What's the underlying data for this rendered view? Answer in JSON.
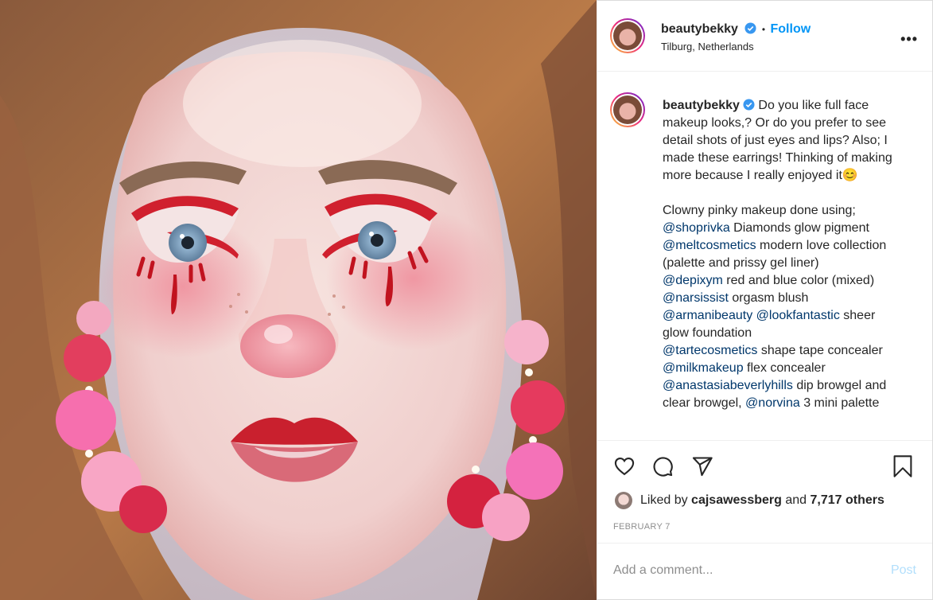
{
  "post": {
    "username": "beautybekky",
    "follow_label": "Follow",
    "separator": "•",
    "location": "Tilburg, Netherlands",
    "more_label": "•••",
    "photo_icon": "portrait-photo"
  },
  "caption": {
    "username": "beautybekky",
    "line1": "Do you like full face makeup looks,? Or do you prefer to see detail shots of just eyes and lips? Also; I made these earrings! Thinking of making more because I really enjoyed it",
    "emoji": "😊",
    "intro": "Clowny pinky makeup done using;",
    "items": [
      {
        "mention": "@shoprivka",
        "text": " Diamonds glow pigment"
      },
      {
        "mention": "@meltcosmetics",
        "text": " modern love collection (palette and prissy gel liner)"
      },
      {
        "mention": "@depixym",
        "text": " red and blue color (mixed)"
      },
      {
        "mention": "@narsissist",
        "text": " orgasm blush"
      },
      {
        "mention": "@armanibeauty",
        "text": " "
      },
      {
        "mention": "@lookfantastic",
        "text": " sheer glow foundation"
      },
      {
        "mention": "@tartecosmetics",
        "text": " shape tape concealer"
      },
      {
        "mention": "@milkmakeup",
        "text": " flex concealer"
      },
      {
        "mention": "@anastasiabeverlyhills",
        "text": " dip browgel and clear browgel, "
      },
      {
        "mention": "@norvina",
        "text": " 3 mini palette"
      }
    ]
  },
  "actions": {
    "like_icon": "heart-icon",
    "comment_icon": "comment-icon",
    "share_icon": "paper-plane-icon",
    "save_icon": "bookmark-icon",
    "liked_prefix": "Liked by ",
    "liked_user": "cajsawessberg",
    "liked_and": " and ",
    "liked_count": "7,717 others",
    "date": "FEBRUARY 7"
  },
  "comment": {
    "placeholder": "Add a comment...",
    "post_label": "Post"
  },
  "colors": {
    "accent": "#0095f6",
    "mention": "#00376b",
    "muted": "#8e8e8e",
    "post_disabled": "#b2dffc"
  }
}
